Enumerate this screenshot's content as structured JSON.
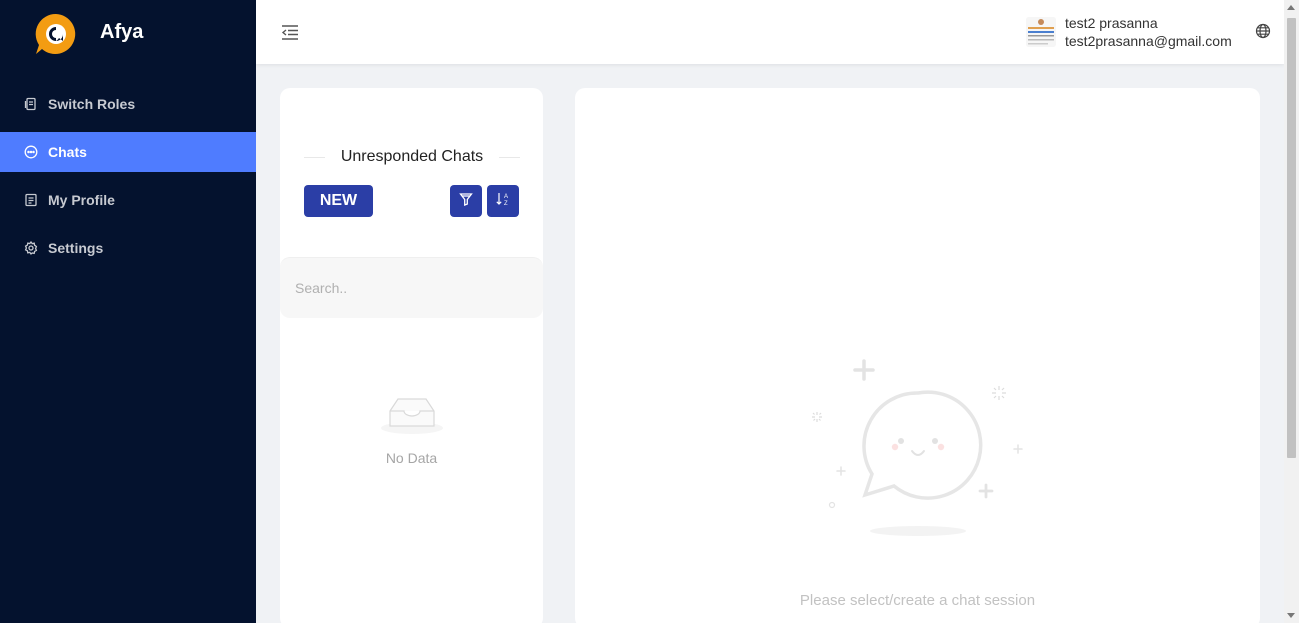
{
  "app": {
    "name": "Afya",
    "brand_color": "#f39c12"
  },
  "sidebar": {
    "items": [
      {
        "label": "Switch Roles",
        "icon": "switch-roles-icon",
        "active": false
      },
      {
        "label": "Chats",
        "icon": "chat-icon",
        "active": true
      },
      {
        "label": "My Profile",
        "icon": "profile-icon",
        "active": false
      },
      {
        "label": "Settings",
        "icon": "gear-icon",
        "active": false
      }
    ]
  },
  "header": {
    "user_name": "test2 prasanna",
    "user_email": "test2prasanna@gmail.com"
  },
  "chat_list": {
    "title": "Unresponded Chats",
    "new_label": "NEW",
    "search_placeholder": "Search..",
    "empty_label": "No Data"
  },
  "chat_view": {
    "hint": "Please select/create a chat session"
  },
  "colors": {
    "sidebar_bg": "#04122e",
    "active_bg": "#4f7cff",
    "button_bg": "#2b3ea6"
  }
}
